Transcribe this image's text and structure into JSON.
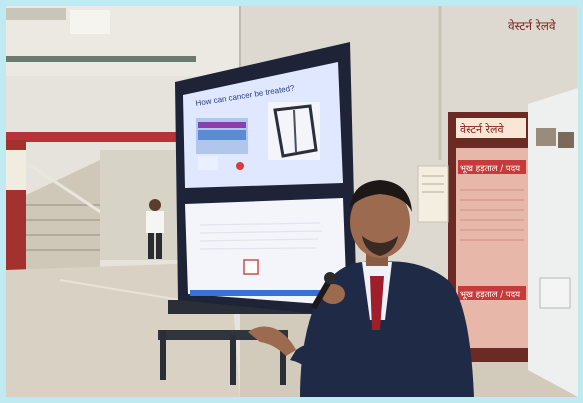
{
  "screen": {
    "slide_top_title": "How can cancer be treated?",
    "slide_bottom_caption": ""
  },
  "signage": {
    "hindi_header": "वेस्टर्न रेलवे",
    "board_heading": "वेस्टर्न रेलवे",
    "notice_line_1": "भूख हड़ताल / पदय",
    "notice_line_2": "भूख हड़ताल / पदय"
  },
  "colors": {
    "border": "#bfeaf2",
    "ceiling": "#e9e7e1",
    "floor": "#d9d2c4",
    "kiosk_frame": "#1e2338",
    "screen_glow": "#dfe8ff",
    "red_board": "#b8323a",
    "suit": "#1f2a46",
    "tie": "#a01d2a"
  }
}
